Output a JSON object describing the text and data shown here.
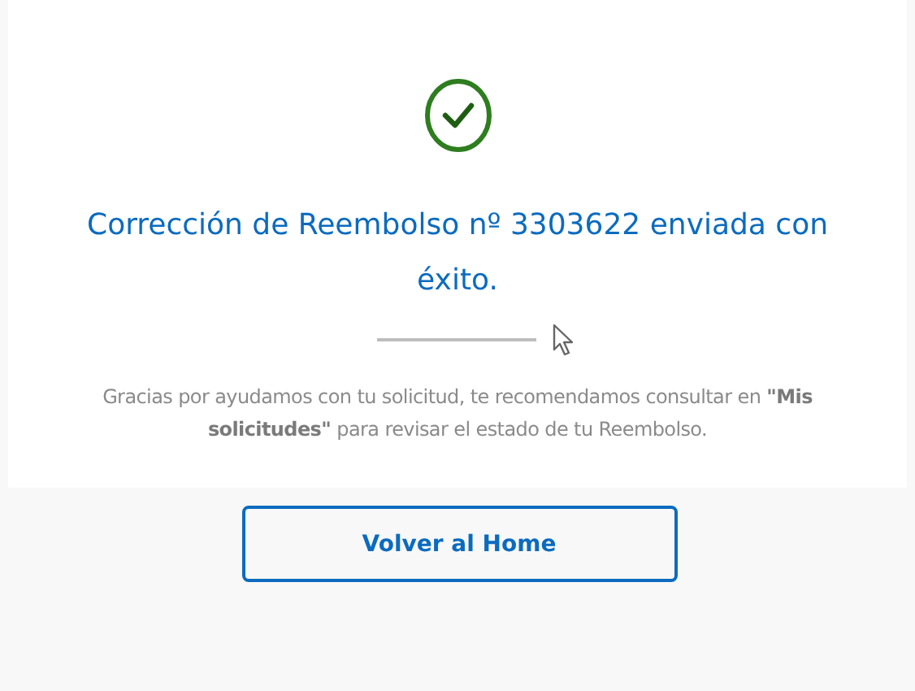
{
  "confirmation": {
    "kind": "success",
    "title": "Corrección de Reembolso nº 3303622 enviada con éxito.",
    "message": "Gracias por ayudamos con tu solicitud, te recomendamos consultar en **\"Mis solicitudes\"** para revisar el estado de tu Reembolso."
  },
  "buttons": [
    {
      "label": "Volver al Home"
    }
  ]
}
